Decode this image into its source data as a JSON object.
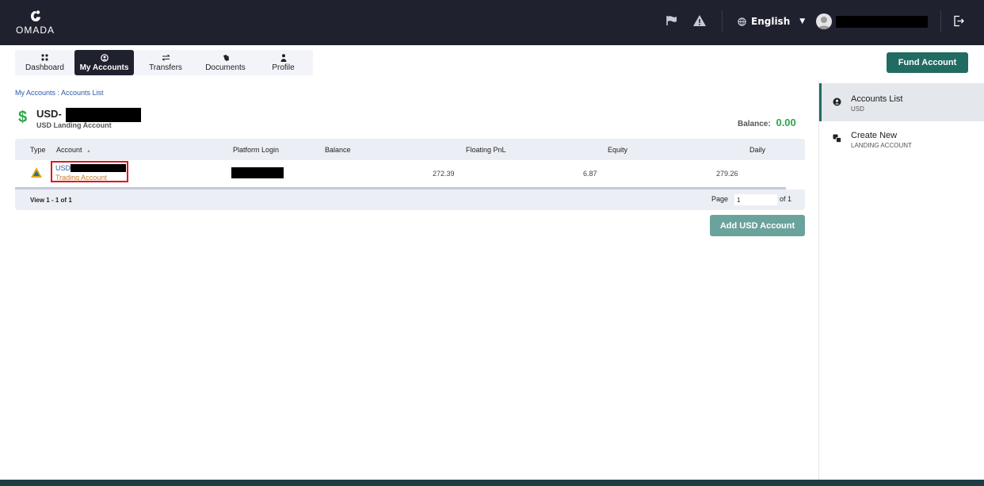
{
  "brand": {
    "name": "OMADA"
  },
  "topbar": {
    "language": "English"
  },
  "nav": {
    "tabs": [
      {
        "label": "Dashboard",
        "icon": "dots-grid-icon"
      },
      {
        "label": "My Accounts",
        "icon": "user-circle-icon",
        "active": true
      },
      {
        "label": "Transfers",
        "icon": "arrows-swap-icon"
      },
      {
        "label": "Documents",
        "icon": "documents-icon"
      },
      {
        "label": "Profile",
        "icon": "person-icon"
      }
    ],
    "fund_button": "Fund Account"
  },
  "main": {
    "breadcrumb": "My Accounts : Accounts List",
    "currency_symbol": "$",
    "account_prefix": "USD-",
    "account_subtitle": "USD Landing Account",
    "balance_label": "Balance:",
    "balance_value": "0.00",
    "table": {
      "headers": {
        "type": "Type",
        "account": "Account",
        "sort_indicator": "▲",
        "platform_login": "Platform Login",
        "balance": "Balance",
        "floating_pnl": "Floating PnL",
        "equity": "Equity",
        "daily": "Daily"
      },
      "rows": [
        {
          "account_prefix": "USD-",
          "account_type": "Trading Account",
          "balance": "272.39",
          "floating_pnl": "6.87",
          "equity": "279.26"
        }
      ],
      "footer": {
        "view_text": "View 1 - 1 of 1",
        "page_label": "Page",
        "page_value": "1",
        "of_label": "of 1"
      }
    },
    "add_button": "Add USD Account"
  },
  "sidebar": {
    "items": [
      {
        "title": "Accounts List",
        "subtitle": "USD",
        "active": true
      },
      {
        "title": "Create New",
        "subtitle": "LANDING ACCOUNT"
      }
    ]
  },
  "colors": {
    "topbar": "#20212f",
    "accent": "#226b63",
    "balance": "#2ea84a",
    "link": "#2c5aa8",
    "highlight": "#e0161a"
  }
}
